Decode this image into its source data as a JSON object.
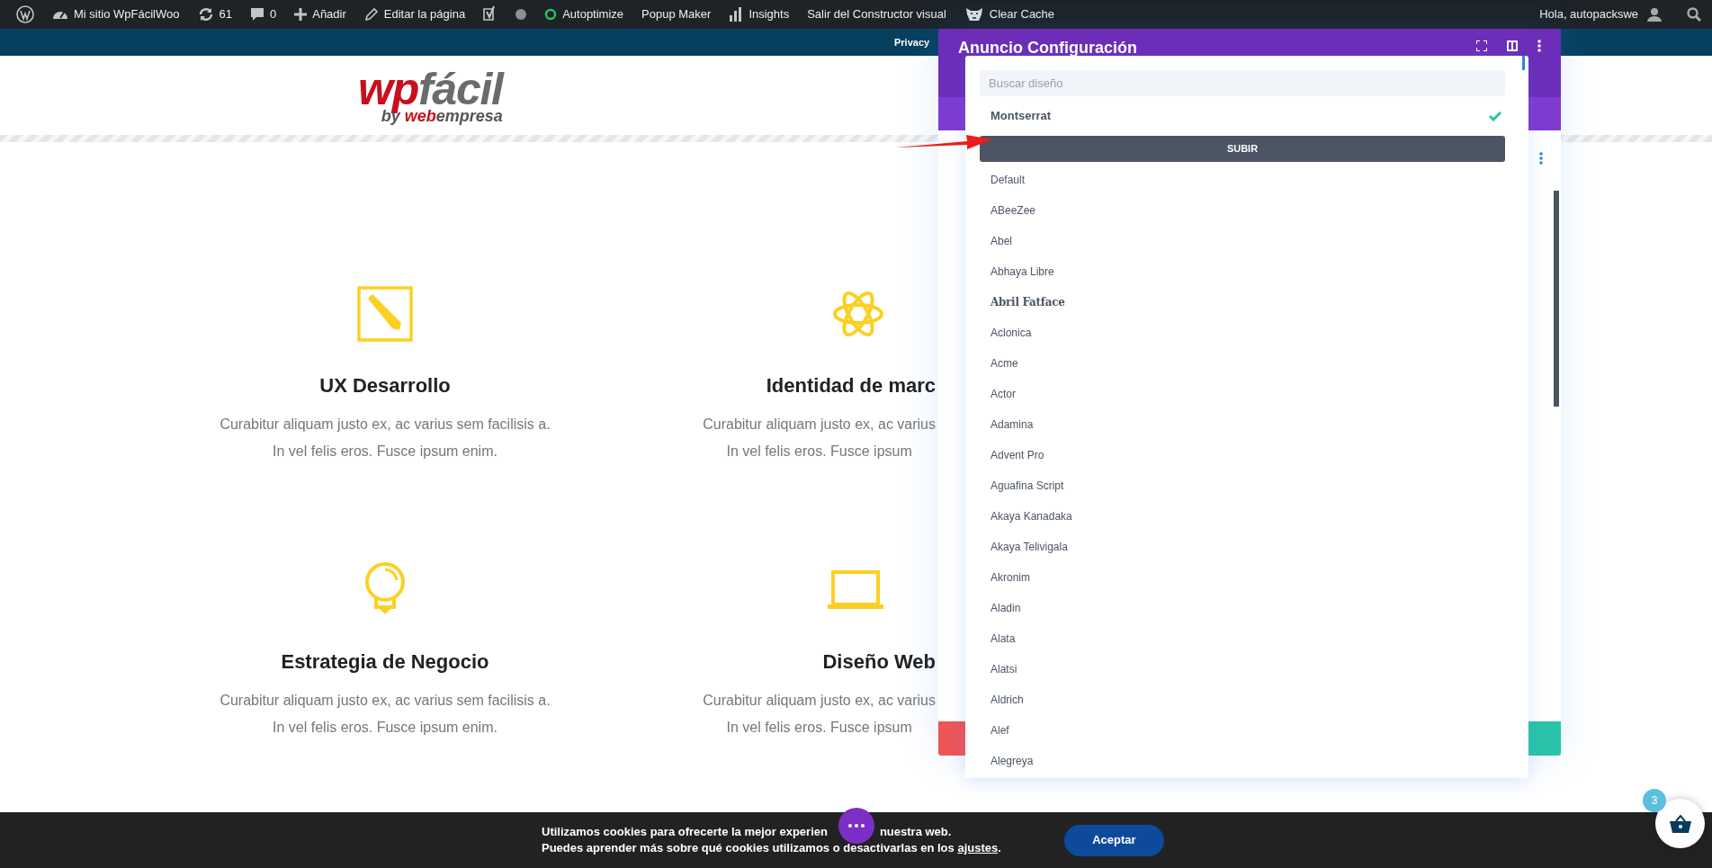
{
  "admin_bar": {
    "items": [
      {
        "text": "Mi sitio WpFácilWoo"
      },
      {
        "text": "61"
      },
      {
        "text": "0"
      },
      {
        "text": "Añadir"
      },
      {
        "text": "Editar la página"
      },
      {
        "text": "Autoptimize"
      },
      {
        "text": "Popup Maker"
      },
      {
        "text": "Insights"
      },
      {
        "text": "Salir del Constructor visual"
      },
      {
        "text": "Clear Cache"
      }
    ],
    "greeting": "Hola, autopackswe"
  },
  "top_bar": {
    "link": "Privacy"
  },
  "logo": {
    "wp": "wp",
    "facil": "fácil",
    "by": "by",
    "web": "web",
    "empresa": "empresa"
  },
  "features": [
    {
      "title": "UX Desarrollo",
      "lines": [
        "Curabitur aliquam justo ex, ac varius sem facilisis a.",
        "In vel felis eros. Fusce ipsum enim."
      ]
    },
    {
      "title": "Identidad de marc",
      "lines": [
        "Curabitur aliquam justo ex, ac varius",
        "In vel felis eros. Fusce ipsum"
      ]
    },
    {
      "title": "Estrategia de Negocio",
      "lines": [
        "Curabitur aliquam justo ex, ac varius sem facilisis a.",
        "In vel felis eros. Fusce ipsum enim."
      ]
    },
    {
      "title": "Diseño Web",
      "lines": [
        "Curabitur aliquam justo ex, ac varius",
        "In vel felis eros. Fusce ipsum"
      ]
    }
  ],
  "settings_modal": {
    "title": "Anuncio Configuración"
  },
  "font_dropdown": {
    "search": {
      "placeholder": "Buscar diseño"
    },
    "current": {
      "label": "Montserrat",
      "selected": true
    },
    "upload_button": "SUBIR",
    "fonts": [
      {
        "label": "Default",
        "kind": "plain",
        "selected": false
      },
      {
        "label": "ABeeZee",
        "kind": "plain",
        "selected": false
      },
      {
        "label": "Abel",
        "kind": "plain",
        "selected": false
      },
      {
        "label": "Abhaya Libre",
        "kind": "plain",
        "selected": false
      },
      {
        "label": "Abril Fatface",
        "kind": "display",
        "selected": false
      },
      {
        "label": "Aclonica",
        "kind": "plain",
        "selected": false
      },
      {
        "label": "Acme",
        "kind": "plain",
        "selected": false
      },
      {
        "label": "Actor",
        "kind": "plain",
        "selected": false
      },
      {
        "label": "Adamina",
        "kind": "plain",
        "selected": false
      },
      {
        "label": "Advent Pro",
        "kind": "plain",
        "selected": false
      },
      {
        "label": "Aguafina Script",
        "kind": "plain",
        "selected": false
      },
      {
        "label": "Akaya Kanadaka",
        "kind": "plain",
        "selected": false
      },
      {
        "label": "Akaya Telivigala",
        "kind": "plain",
        "selected": false
      },
      {
        "label": "Akronim",
        "kind": "plain",
        "selected": false
      },
      {
        "label": "Aladin",
        "kind": "plain",
        "selected": false
      },
      {
        "label": "Alata",
        "kind": "plain",
        "selected": false
      },
      {
        "label": "Alatsi",
        "kind": "plain",
        "selected": false
      },
      {
        "label": "Aldrich",
        "kind": "plain",
        "selected": false
      },
      {
        "label": "Alef",
        "kind": "plain",
        "selected": false
      },
      {
        "label": "Alegreya",
        "kind": "plain",
        "selected": false
      }
    ]
  },
  "cookie_bar": {
    "line1_start": "Utilizamos cookies para ofrecerte la mejor experien",
    "line1_end": "nuestra web.",
    "line2": "Puedes aprender más sobre qué cookies utilizamos o desactivarlas en los ",
    "link": "ajustes",
    "line2_end": ".",
    "button": "Aceptar"
  },
  "cart": {
    "count": "3"
  }
}
